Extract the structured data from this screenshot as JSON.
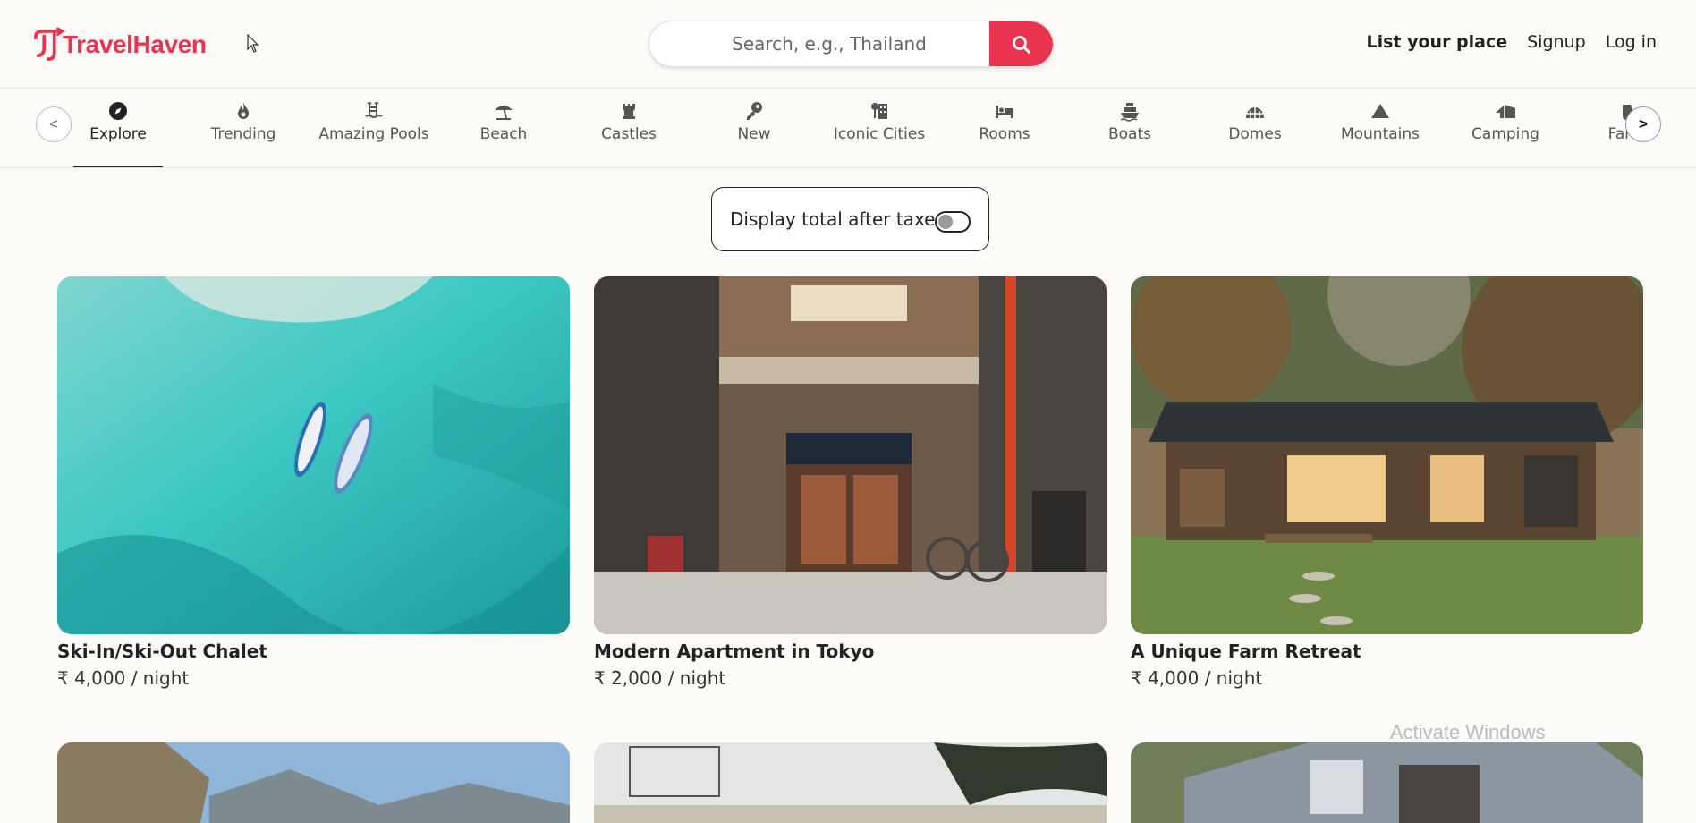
{
  "brand": {
    "name": "TravelHaven",
    "color": "#e8344e"
  },
  "search": {
    "placeholder": "Search, e.g., Thailand",
    "button_icon": "search-icon"
  },
  "nav": {
    "list_place": "List your place",
    "signup": "Signup",
    "login": "Log in"
  },
  "categories": [
    {
      "label": "Explore",
      "icon": "compass-icon",
      "active": true
    },
    {
      "label": "Trending",
      "icon": "flame-icon"
    },
    {
      "label": "Amazing Pools",
      "icon": "pool-icon"
    },
    {
      "label": "Beach",
      "icon": "umbrella-icon"
    },
    {
      "label": "Castles",
      "icon": "castle-icon"
    },
    {
      "label": "New",
      "icon": "key-icon"
    },
    {
      "label": "Iconic Cities",
      "icon": "city-icon"
    },
    {
      "label": "Rooms",
      "icon": "bed-icon"
    },
    {
      "label": "Boats",
      "icon": "ship-icon"
    },
    {
      "label": "Domes",
      "icon": "dome-icon"
    },
    {
      "label": "Mountains",
      "icon": "mountain-icon"
    },
    {
      "label": "Camping",
      "icon": "tent-icon"
    },
    {
      "label": "Farms",
      "icon": "tractor-icon"
    }
  ],
  "carousel": {
    "prev": "<",
    "next": ">"
  },
  "tax_toggle": {
    "label": "Display total after taxes",
    "enabled": false
  },
  "listings": [
    {
      "title": "Ski-In/Ski-Out Chalet",
      "price": "₹ 4,000 / night"
    },
    {
      "title": "Modern Apartment in Tokyo",
      "price": "₹ 2,000 / night"
    },
    {
      "title": "A Unique Farm Retreat",
      "price": "₹ 4,000 / night"
    }
  ],
  "watermark": "Activate Windows"
}
